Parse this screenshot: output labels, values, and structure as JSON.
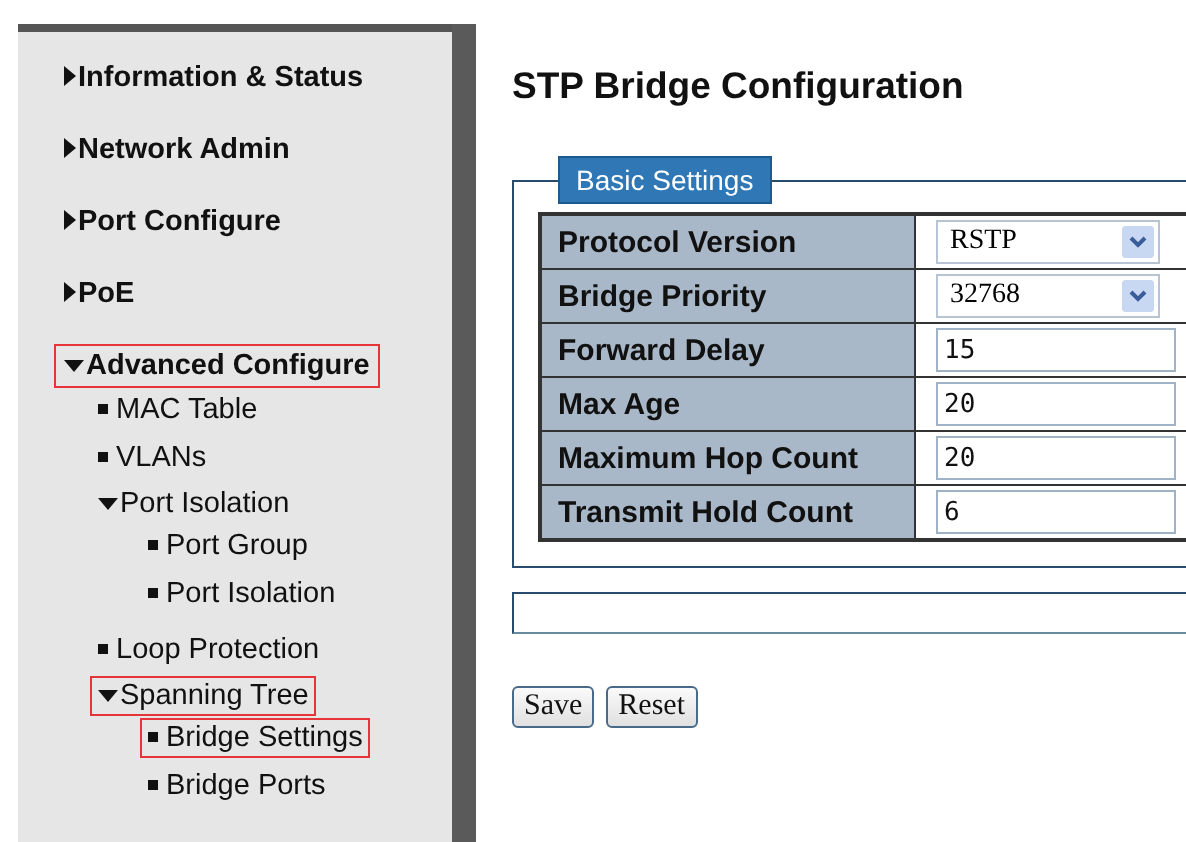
{
  "sidebar": {
    "items": [
      {
        "label": "Information & Status",
        "kind": "group",
        "expanded": false,
        "highlighted": false
      },
      {
        "label": "Network Admin",
        "kind": "group",
        "expanded": false,
        "highlighted": false
      },
      {
        "label": "Port Configure",
        "kind": "group",
        "expanded": false,
        "highlighted": false
      },
      {
        "label": "PoE",
        "kind": "group",
        "expanded": false,
        "highlighted": false
      },
      {
        "label": "Advanced Configure",
        "kind": "group",
        "expanded": true,
        "highlighted": true,
        "children": [
          {
            "label": "MAC Table",
            "kind": "page",
            "highlighted": false
          },
          {
            "label": "VLANs",
            "kind": "page",
            "highlighted": false
          },
          {
            "label": "Port Isolation",
            "kind": "group",
            "expanded": true,
            "highlighted": false,
            "children": [
              {
                "label": "Port Group",
                "kind": "page",
                "highlighted": false
              },
              {
                "label": "Port Isolation",
                "kind": "page",
                "highlighted": false
              }
            ]
          },
          {
            "label": "Loop Protection",
            "kind": "page",
            "highlighted": false
          },
          {
            "label": "Spanning Tree",
            "kind": "group",
            "expanded": true,
            "highlighted": true,
            "children": [
              {
                "label": "Bridge Settings",
                "kind": "page",
                "highlighted": true
              },
              {
                "label": "Bridge Ports",
                "kind": "page",
                "highlighted": false
              }
            ]
          }
        ]
      }
    ]
  },
  "form": {
    "title": "STP Bridge Configuration",
    "legend": "Basic Settings",
    "rows": [
      {
        "label": "Protocol Version",
        "kind": "select",
        "value": "RSTP"
      },
      {
        "label": "Bridge Priority",
        "kind": "select",
        "value": "32768"
      },
      {
        "label": "Forward Delay",
        "kind": "input",
        "value": "15"
      },
      {
        "label": "Max Age",
        "kind": "input",
        "value": "20"
      },
      {
        "label": "Maximum Hop Count",
        "kind": "input",
        "value": "20"
      },
      {
        "label": "Transmit Hold Count",
        "kind": "input",
        "value": "6"
      }
    ],
    "buttons": [
      "Save",
      "Reset"
    ]
  }
}
